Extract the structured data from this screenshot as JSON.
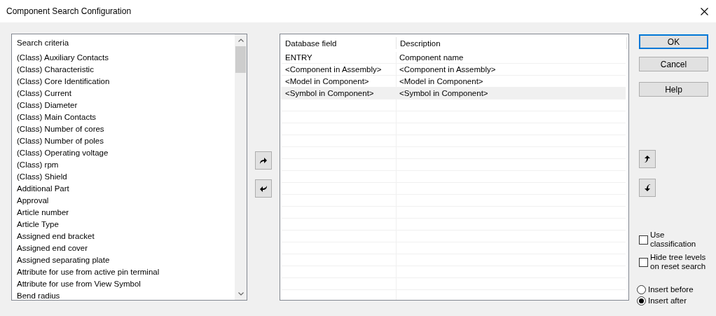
{
  "window": {
    "title": "Component Search Configuration"
  },
  "search_criteria": {
    "header": "Search criteria",
    "items": [
      "(Class) Auxiliary Contacts",
      "(Class) Characteristic",
      "(Class) Core Identification",
      "(Class) Current",
      "(Class) Diameter",
      "(Class) Main Contacts",
      "(Class) Number of cores",
      "(Class) Number of poles",
      "(Class) Operating voltage",
      "(Class) rpm",
      "(Class) Shield",
      "Additional Part",
      "Approval",
      "Article number",
      "Article Type",
      "Assigned end bracket",
      "Assigned end cover",
      "Assigned separating plate",
      "Attribute for use from active pin terminal",
      "Attribute for use from View Symbol",
      "Bend radius"
    ]
  },
  "fields_table": {
    "columns": [
      "Database field",
      "Description"
    ],
    "rows": [
      {
        "cells": [
          "ENTRY",
          "Component name"
        ],
        "selected": false
      },
      {
        "cells": [
          "<Component in Assembly>",
          "<Component in Assembly>"
        ],
        "selected": false
      },
      {
        "cells": [
          "<Model in Component>",
          "<Model in Component>"
        ],
        "selected": false
      },
      {
        "cells": [
          "<Symbol in Component>",
          "<Symbol in Component>"
        ],
        "selected": true
      }
    ]
  },
  "buttons": [
    {
      "label": "OK",
      "default": true
    },
    {
      "label": "Cancel",
      "default": false
    },
    {
      "label": "Help",
      "default": false
    }
  ],
  "options": [
    {
      "kind": "checkbox",
      "label": "Use classification",
      "checked": false
    },
    {
      "kind": "checkbox",
      "label": "Hide tree levels on reset search",
      "checked": false
    },
    {
      "kind": "radio",
      "label": "Insert before",
      "selected": false
    },
    {
      "kind": "radio",
      "label": "Insert after",
      "selected": true
    }
  ]
}
